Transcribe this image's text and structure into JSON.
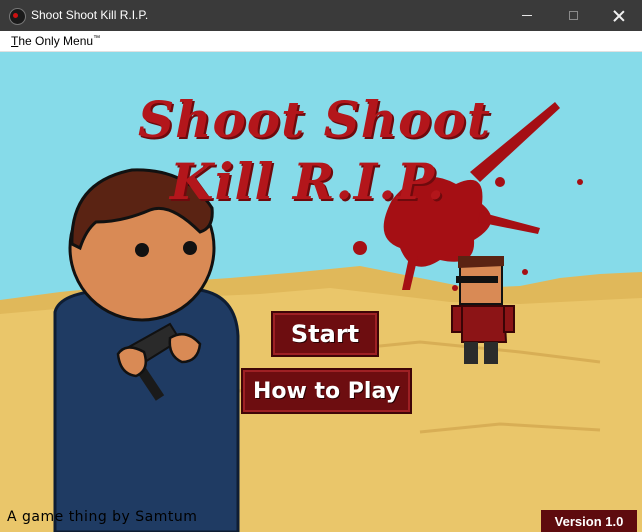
{
  "window": {
    "title": "Shoot Shoot Kill R.I.P.",
    "app_icon": "skull-app-icon",
    "controls": [
      "minimize-icon",
      "maximize-icon",
      "close-icon"
    ]
  },
  "menu": {
    "item_mnemonic": "T",
    "item_rest": "he Only Menu",
    "item_mark": "™"
  },
  "game": {
    "logo_line1": "Shoot Shoot",
    "logo_line2": "Kill R.I.P.",
    "start_label": "Start",
    "how_to_play_label": "How to Play",
    "credits": "A game thing by Samtum",
    "version": "Version 1.0"
  },
  "colors": {
    "sky": "#7fd6e6",
    "sand": "#eac66a",
    "blood_red": "#b3161b",
    "button_red": "#6d0d10"
  }
}
